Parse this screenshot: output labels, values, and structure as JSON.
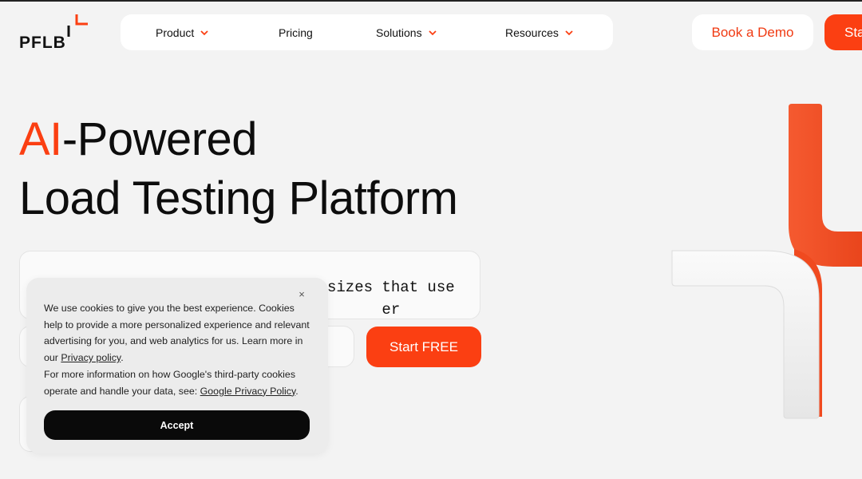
{
  "brand": {
    "logo_text": "PFLB"
  },
  "nav": {
    "items": [
      {
        "label": "Product",
        "has_dropdown": true
      },
      {
        "label": "Pricing",
        "has_dropdown": false
      },
      {
        "label": "Solutions",
        "has_dropdown": true
      },
      {
        "label": "Resources",
        "has_dropdown": true
      }
    ]
  },
  "header_actions": {
    "book_demo_label": "Book a Demo",
    "start_label": "Sta"
  },
  "hero": {
    "title_accent": "AI",
    "title_line1_rest": "-Powered",
    "title_line2": "Load Testing Platform",
    "input_visible_text": "sizes that use\n      er",
    "start_free_label": "Start FREE"
  },
  "cookie": {
    "close_glyph": "×",
    "text_part1": "We use cookies to give you the best experience. Cookies help to provide a more personalized experience and relevant advertising for you, and web analytics for us. Learn more in our ",
    "privacy_link": "Privacy policy",
    "text_part2": ".",
    "text_part3": "For more information on how Google's third-party cookies operate and handle your data, see: ",
    "google_link": "Google Privacy Policy",
    "text_part4": ".",
    "accept_label": "Accept"
  },
  "colors": {
    "accent": "#fb3f12",
    "background": "#f3f3f3",
    "button_dark": "#0a0a0a"
  },
  "icons": {
    "dropdown": "chevron-down-icon",
    "close": "close-icon",
    "logo_mark": "corner-mark-icon"
  }
}
